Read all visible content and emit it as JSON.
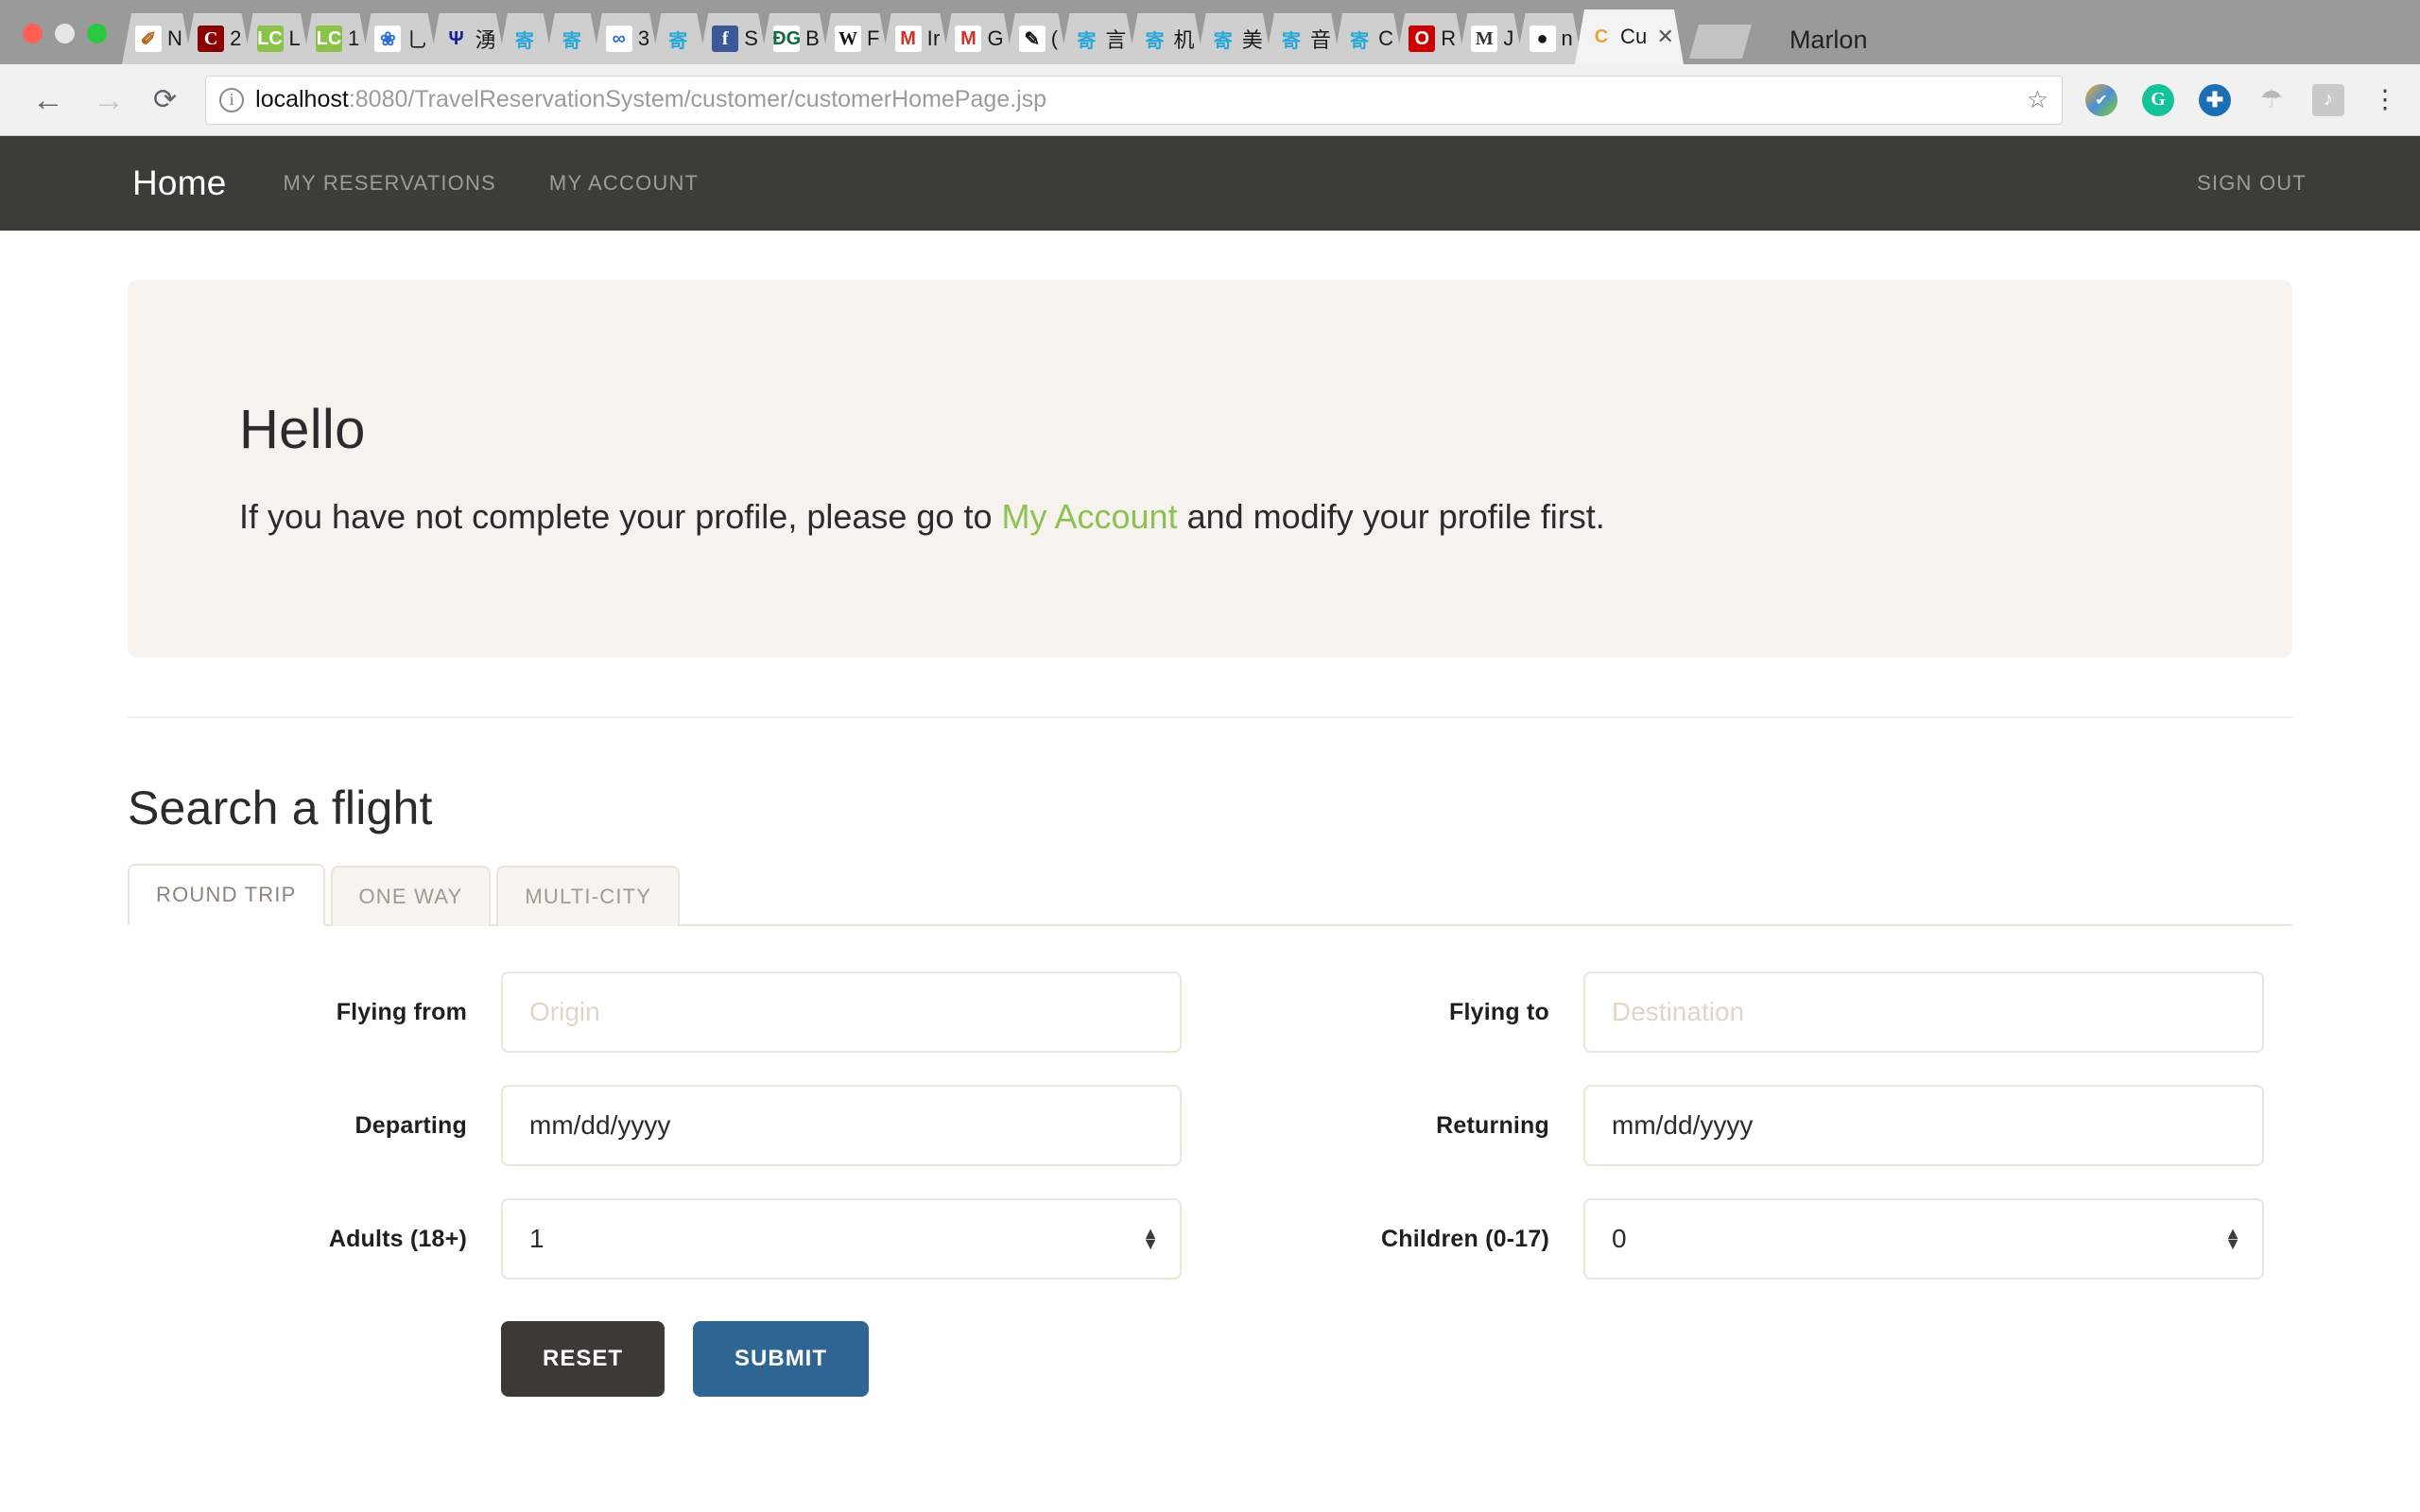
{
  "browser": {
    "profile_name": "Marlon",
    "traffic_lights": [
      "close",
      "minimize",
      "maximize"
    ],
    "url_host": "localhost",
    "url_rest": ":8080/TravelReservationSystem/customer/customerHomePage.jsp",
    "tabs": [
      {
        "favicon": "notebook-icon",
        "glyph": "✐",
        "label": "N",
        "class": "fv-notebook",
        "active": false
      },
      {
        "favicon": "coursera-icon",
        "glyph": "C",
        "label": "2",
        "class": "fv-c",
        "active": false
      },
      {
        "favicon": "leetcode-icon",
        "glyph": "LC",
        "label": "L",
        "class": "fv-lc",
        "active": false
      },
      {
        "favicon": "leetcode-icon",
        "glyph": "LC",
        "label": "1",
        "class": "fv-lc",
        "active": false
      },
      {
        "favicon": "baidu-icon",
        "glyph": "❀",
        "label": "乚",
        "class": "fv-blue-flower",
        "active": false
      },
      {
        "favicon": "psi-icon",
        "glyph": "Ψ",
        "label": "湧",
        "class": "fv-psi",
        "active": false
      },
      {
        "favicon": "zhihu-icon",
        "glyph": "寄",
        "label": "",
        "class": "fv-cyan",
        "active": false
      },
      {
        "favicon": "zhihu-icon",
        "glyph": "寄",
        "label": "",
        "class": "fv-cyan",
        "active": false
      },
      {
        "favicon": "skype-icon",
        "glyph": "∞",
        "label": "3",
        "class": "fv-blue-flower",
        "active": false
      },
      {
        "favicon": "zhihu-icon",
        "glyph": "寄",
        "label": "",
        "class": "fv-cyan",
        "active": false
      },
      {
        "favicon": "facebook-icon",
        "glyph": "f",
        "label": "S",
        "class": "fv-fb",
        "active": false
      },
      {
        "favicon": "duckduckgo-icon",
        "glyph": "ĐG",
        "label": "B",
        "class": "fv-dg",
        "active": false
      },
      {
        "favicon": "wikipedia-icon",
        "glyph": "W",
        "label": "F",
        "class": "fv-w",
        "active": false
      },
      {
        "favicon": "gmail-icon",
        "glyph": "M",
        "label": "Ir",
        "class": "fv-gmail",
        "active": false
      },
      {
        "favicon": "gmail-icon",
        "glyph": "M",
        "label": "G",
        "class": "fv-gmail",
        "active": false
      },
      {
        "favicon": "pen-icon",
        "glyph": "✎",
        "label": "(",
        "class": "fv-pen",
        "active": false
      },
      {
        "favicon": "zhihu-icon",
        "glyph": "寄",
        "label": "言",
        "class": "fv-cyan",
        "active": false
      },
      {
        "favicon": "zhihu-icon",
        "glyph": "寄",
        "label": "机",
        "class": "fv-cyan",
        "active": false
      },
      {
        "favicon": "zhihu-icon",
        "glyph": "寄",
        "label": "美",
        "class": "fv-cyan",
        "active": false
      },
      {
        "favicon": "zhihu-icon",
        "glyph": "寄",
        "label": "音",
        "class": "fv-cyan",
        "active": false
      },
      {
        "favicon": "zhihu-icon",
        "glyph": "寄",
        "label": "C",
        "class": "fv-cyan",
        "active": false
      },
      {
        "favicon": "opera-icon",
        "glyph": "O",
        "label": "R",
        "class": "fv-o",
        "active": false
      },
      {
        "favicon": "medium-icon",
        "glyph": "M",
        "label": "J",
        "class": "fv-m",
        "active": false
      },
      {
        "favicon": "github-icon",
        "glyph": "●",
        "label": "n",
        "class": "fv-gh",
        "active": false
      },
      {
        "favicon": "customer-page-icon",
        "glyph": "C",
        "label": "Cu",
        "class": "fv-cu",
        "active": true
      }
    ],
    "extensions": [
      {
        "name": "colorzilla-extension-icon",
        "glyph": "✔",
        "class": "ei-colorzilla"
      },
      {
        "name": "grammarly-extension-icon",
        "glyph": "G",
        "class": "ei-grammarly"
      },
      {
        "name": "add-extension-icon",
        "glyph": "✚",
        "class": "ei-plus"
      },
      {
        "name": "parachute-extension-icon",
        "glyph": "☂",
        "class": "ei-parachute"
      },
      {
        "name": "screenshot-extension-icon",
        "glyph": "♪",
        "class": "ei-frame"
      },
      {
        "name": "chrome-menu-icon",
        "glyph": "⋮",
        "class": "ei-kebab"
      }
    ],
    "back_glyph": "←",
    "forward_glyph": "→",
    "reload_glyph": "⟳",
    "star_glyph": "☆",
    "close_tab_glyph": "✕"
  },
  "site": {
    "brand": "Home",
    "nav": [
      {
        "label": "MY RESERVATIONS"
      },
      {
        "label": "MY ACCOUNT"
      }
    ],
    "sign_out": "SIGN OUT",
    "colors": {
      "navbar_bg": "#3d3d38",
      "jumbotron_bg": "#f6f3ee",
      "link_green": "#8ec153",
      "submit_blue": "#2e6593",
      "reset_dark": "#3d3a35"
    }
  },
  "jumbotron": {
    "title": "Hello",
    "text_before": "If you have not complete your profile, please go to ",
    "link_label": "My Account",
    "text_after": " and modify your profile first."
  },
  "search": {
    "section_title": "Search a flight",
    "tabs": [
      {
        "label": "ROUND TRIP",
        "active": true
      },
      {
        "label": "ONE WAY",
        "active": false
      },
      {
        "label": "MULTI-CITY",
        "active": false
      }
    ],
    "fields": {
      "flying_from_label": "Flying from",
      "flying_from_placeholder": "Origin",
      "flying_from_value": "",
      "flying_to_label": "Flying to",
      "flying_to_placeholder": "Destination",
      "flying_to_value": "",
      "departing_label": "Departing",
      "departing_value": "mm/dd/yyyy",
      "returning_label": "Returning",
      "returning_value": "mm/dd/yyyy",
      "adults_label": "Adults (18+)",
      "adults_value": "1",
      "children_label": "Children (0-17)",
      "children_value": "0"
    },
    "buttons": {
      "reset": "RESET",
      "submit": "SUBMIT"
    }
  }
}
